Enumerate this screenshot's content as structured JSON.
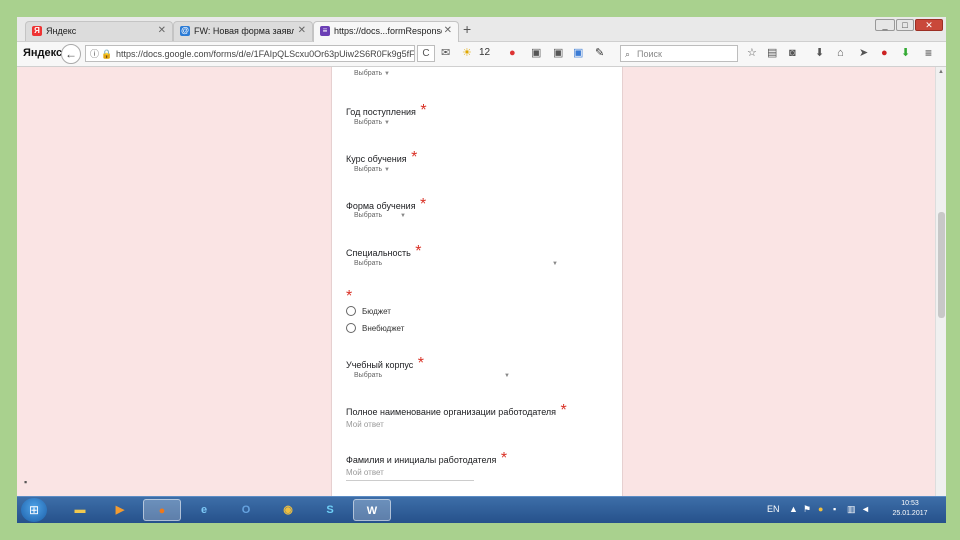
{
  "tabs": [
    {
      "label": "Яндекс",
      "icon": "Я"
    },
    {
      "label": "FW: Новая форма заявле...",
      "icon": "@"
    },
    {
      "label": "https://docs...formResponse",
      "icon": "≡"
    }
  ],
  "new_tab": "+",
  "window": {
    "minimize": "_",
    "maximize": "□",
    "close": "✕"
  },
  "toolbar": {
    "logo": "Яндекс",
    "back": "←",
    "url": "https://docs.google.com/forms/d/e/1FAIpQLScxu0Or63pUiw2S6R0Fk9g5fF",
    "reload": "C",
    "weather_temp": "12",
    "search_placeholder": "Поиск"
  },
  "form": {
    "dropdown_placeholder": "Выбрать",
    "top_dropdown": "Выбрать",
    "questions": [
      {
        "label": "Год поступления",
        "required": "*"
      },
      {
        "label": "Курс обучения",
        "required": "*"
      },
      {
        "label": "Форма обучения",
        "required": "*"
      },
      {
        "label": "Специальность",
        "required": "*"
      },
      {
        "label": "Учебный корпус",
        "required": "*"
      },
      {
        "label": "Полное наименование организации работодателя",
        "required": "*"
      },
      {
        "label": "Фамилия и инициалы работодателя",
        "required": "*"
      }
    ],
    "radio_required": "*",
    "radio_options": [
      "Бюджет",
      "Внебюджет"
    ],
    "answer_placeholder": "Мой ответ"
  },
  "taskbar": {
    "lang": "EN",
    "time": "10:53",
    "date": "25.01.2017"
  }
}
